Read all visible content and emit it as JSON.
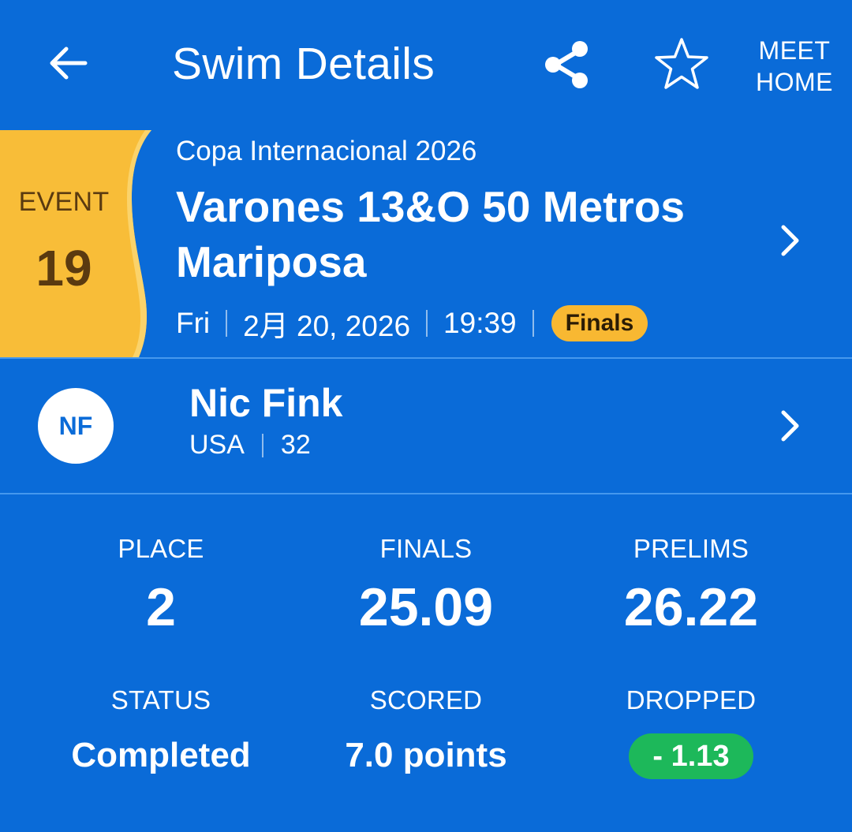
{
  "header": {
    "title": "Swim Details",
    "back_icon": "arrow-left-icon",
    "share_icon": "share-icon",
    "favorite_icon": "star-outline-icon",
    "meet_home_line1": "MEET",
    "meet_home_line2": "HOME"
  },
  "event": {
    "label": "EVENT",
    "number": "19",
    "meet_name": "Copa Internacional 2026",
    "name": "Varones 13&O 50 Metros Mariposa",
    "day": "Fri",
    "date": "2月 20, 2026",
    "time": "19:39",
    "round": "Finals"
  },
  "swimmer": {
    "initials": "NF",
    "name": "Nic Fink",
    "team": "USA",
    "age": "32"
  },
  "stats": {
    "place_label": "PLACE",
    "place_value": "2",
    "finals_label": "FINALS",
    "finals_value": "25.09",
    "prelims_label": "PRELIMS",
    "prelims_value": "26.22",
    "status_label": "STATUS",
    "status_value": "Completed",
    "scored_label": "SCORED",
    "scored_value": "7.0 points",
    "dropped_label": "DROPPED",
    "dropped_value": "- 1.13"
  },
  "colors": {
    "background": "#0a6bd8",
    "event_badge": "#f8b832",
    "event_badge_text": "#5a3a10",
    "round_badge": "#f8b832",
    "dropped_badge": "#1db85a",
    "divider": "#78beff"
  }
}
